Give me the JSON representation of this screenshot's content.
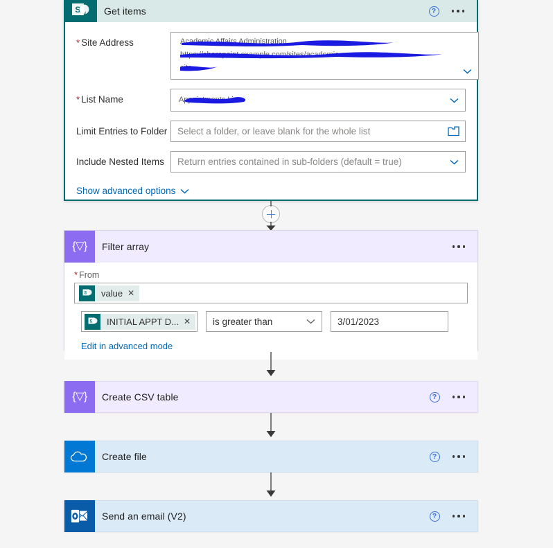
{
  "flow": {
    "nodes": [
      {
        "id": "get-items",
        "title": "Get items",
        "connector": "sharepoint",
        "state": "expanded-selected",
        "help_label": "?",
        "fields": [
          {
            "label": "Site Address",
            "required": true,
            "value": "",
            "redacted": true,
            "control": "combobox"
          },
          {
            "label": "List Name",
            "required": true,
            "value": "",
            "redacted": true,
            "control": "combobox"
          },
          {
            "label": "Limit Entries to Folder",
            "required": false,
            "value": "",
            "placeholder": "Select a folder, or leave blank for the whole list",
            "control": "folder-picker"
          },
          {
            "label": "Include Nested Items",
            "required": false,
            "value": "",
            "placeholder": "Return entries contained in sub-folders (default = true)",
            "control": "combobox"
          }
        ],
        "advanced_options_label": "Show advanced options"
      },
      {
        "id": "filter-array",
        "title": "Filter array",
        "connector": "data-operation",
        "state": "expanded",
        "from_label": "From",
        "from_required": true,
        "from_token": "value",
        "condition": {
          "left_token": "INITIAL APPT D...",
          "operator": "is greater than",
          "right_value": "3/01/2023"
        },
        "advanced_mode_label": "Edit in advanced mode"
      },
      {
        "id": "create-csv-table",
        "title": "Create CSV table",
        "connector": "data-operation",
        "state": "collapsed",
        "help_label": "?"
      },
      {
        "id": "create-file",
        "title": "Create file",
        "connector": "onedrive",
        "state": "collapsed",
        "help_label": "?"
      },
      {
        "id": "send-an-email",
        "title": "Send an email (V2)",
        "connector": "outlook",
        "state": "collapsed",
        "help_label": "?"
      }
    ],
    "insert_button_label": "+"
  },
  "colors": {
    "sharepoint_teal": "#036c70",
    "data_operation_purple": "#8c6cf0",
    "onedrive_blue": "#0078d4",
    "outlook_blue": "#0a5ca8",
    "selected_border": "#036c70",
    "link_blue": "#0067b8",
    "required_red": "#a4262c",
    "redaction_blue": "#1a1ae0",
    "canvas_background": "#f5f5f5"
  }
}
